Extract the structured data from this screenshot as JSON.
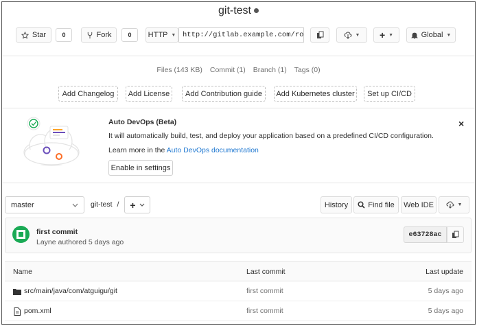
{
  "header": {
    "title": "git-test",
    "star_label": "Star",
    "star_count": "0",
    "fork_label": "Fork",
    "fork_count": "0",
    "protocol": "HTTP",
    "clone_url": "http://gitlab.example.com/roo",
    "notifications_label": "Global"
  },
  "stats": {
    "files": "Files (143 KB)",
    "commits": "Commit (1)",
    "branches": "Branch (1)",
    "tags": "Tags (0)"
  },
  "quick_actions": [
    "Add Changelog",
    "Add License",
    "Add Contribution guide",
    "Add Kubernetes cluster",
    "Set up CI/CD"
  ],
  "devops": {
    "title": "Auto DevOps (Beta)",
    "text": "It will automatically build, test, and deploy your application based on a predefined CI/CD configuration.",
    "learn_prefix": "Learn more in the ",
    "learn_link": "Auto DevOps documentation",
    "enable_label": "Enable in settings",
    "close_glyph": "×"
  },
  "repo_nav": {
    "branch": "master",
    "path": "git-test",
    "separator": "/",
    "history_label": "History",
    "find_file_label": "Find file",
    "web_ide_label": "Web IDE"
  },
  "last_commit": {
    "message": "first commit",
    "author_line": "Layne authored 5 days ago",
    "sha": "e63728ac"
  },
  "files_table": {
    "headers": {
      "name": "Name",
      "last_commit": "Last commit",
      "last_update": "Last update"
    },
    "rows": [
      {
        "name": "src/main/java/com/atguigu/git",
        "commit": "first commit",
        "updated": "5 days ago",
        "icon": "folder-icon"
      },
      {
        "name": "pom.xml",
        "commit": "first commit",
        "updated": "5 days ago",
        "icon": "file-icon"
      }
    ]
  },
  "colors": {
    "link": "#1f78d1",
    "avatar_green": "#1aaa55"
  }
}
